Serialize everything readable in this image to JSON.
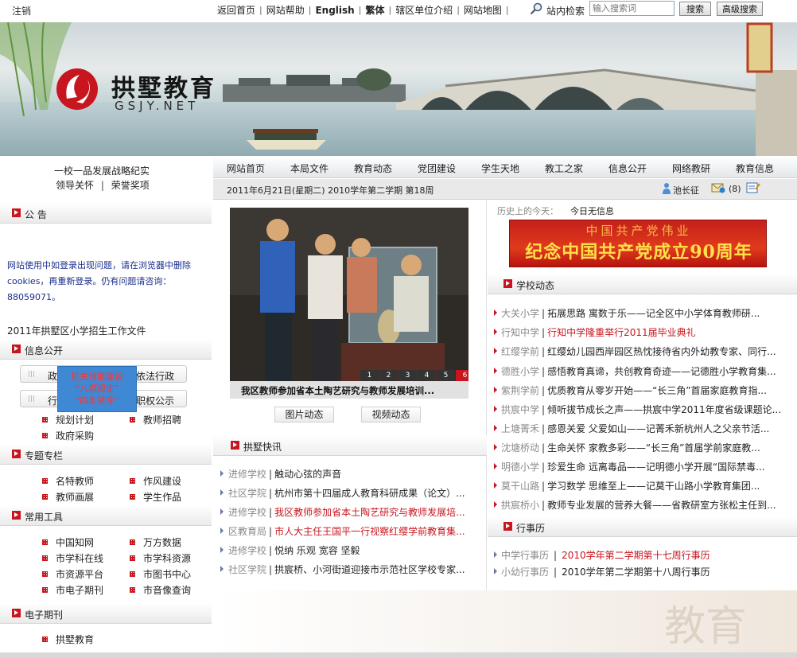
{
  "topbar": {
    "logout": "注销",
    "nav": [
      "返回首页",
      "网站帮助",
      "English",
      "繁体",
      "辖区单位介绍",
      "网站地图"
    ],
    "search_label": "站内检索",
    "search_placeholder": "输入搜索词",
    "search_button": "搜索",
    "advanced_button": "高级搜索"
  },
  "banner": {
    "logo_cn": "拱墅教育",
    "logo_en": "GSJY.NET"
  },
  "left": {
    "strategy_title": "一校一品发展战略纪实",
    "strategy_link1": "领导关怀",
    "strategy_sep": "|",
    "strategy_link2": "荣誉奖项",
    "notice_title": "公 告",
    "notice_text": "网站使用中如登录出现问题，请在浏览器中删除cookies，再重新登录。仍有问题请咨询：88059071。",
    "enroll_text": "2011年拱墅区小学招生工作文件",
    "info_title": "信息公开",
    "info_pills": [
      "政",
      "依法行政",
      "行",
      "职权公示"
    ],
    "popup_lines": [
      "机关效能建设",
      "“八项规定”",
      "“四条禁令”"
    ],
    "info_links": [
      "规划计划",
      "教师招聘",
      "政府采购"
    ],
    "special_title": "专题专栏",
    "special_links": [
      "名特教师",
      "作风建设",
      "教师画展",
      "学生作品"
    ],
    "tools_title": "常用工具",
    "tools_links": [
      "中国知网",
      "万方数据",
      "市学科在线",
      "市学科资源",
      "市资源平台",
      "市图书中心",
      "市电子期刊",
      "市音像查询"
    ],
    "journal_title": "电子期刊",
    "journal_links": [
      "拱墅教育"
    ]
  },
  "mainnav": {
    "items": [
      "网站首页",
      "本局文件",
      "教育动态",
      "党团建设",
      "学生天地",
      "教工之家",
      "信息公开",
      "网络教研",
      "教育信息"
    ]
  },
  "datebar": {
    "date": "2011年6月21日(星期二) 2010学年第二学期 第18周",
    "user": "池长征",
    "mail_count": "(8)"
  },
  "center": {
    "photo_caption": "我区教师参加省本土陶艺研究与教师发展培训...",
    "slide_numbers": [
      "1",
      "2",
      "3",
      "4",
      "5",
      "6"
    ],
    "tab_photo": "图片动态",
    "tab_video": "视频动态",
    "news_title": "拱墅快讯",
    "news": [
      {
        "src": "进修学校",
        "title": "触动心弦的声音",
        "red": false
      },
      {
        "src": "社区学院",
        "title": "杭州市第十四届成人教育科研成果（论文）...",
        "red": false
      },
      {
        "src": "进修学校",
        "title": "我区教师参加省本土陶艺研究与教师发展培...",
        "red": true
      },
      {
        "src": "区教育局",
        "title": "市人大主任王国平一行视察红缨学前教育集...",
        "red": true
      },
      {
        "src": "进修学校",
        "title": "悦纳 乐观 宽容 坚毅",
        "red": false
      },
      {
        "src": "社区学院",
        "title": "拱宸桥、小河街道迎接市示范社区学校专家...",
        "red": false
      }
    ]
  },
  "right": {
    "history_label": "历史上的今天：",
    "history_text": "今日无信息",
    "party_top": "中国共产党伟业",
    "party_main": "纪念中国共产党成立90周年",
    "school_news_title": "学校动态",
    "school_news": [
      {
        "src": "大关小学",
        "title": "拓展思路 寓数于乐——记全区中小学体育教师研...",
        "red": false
      },
      {
        "src": "行知中学",
        "title": "行知中学隆重举行2011届毕业典礼",
        "red": true
      },
      {
        "src": "红缨学前",
        "title": "红缨幼儿园西岸园区热忱接待省内外幼教专家、同行...",
        "red": false
      },
      {
        "src": "德胜小学",
        "title": "感悟教育真谛，共创教育奇迹——记德胜小学教育集...",
        "red": false
      },
      {
        "src": "紫荆学前",
        "title": "优质教育从零岁开始——“长三角”首届家庭教育指...",
        "red": false
      },
      {
        "src": "拱宸中学",
        "title": "倾听拔节成长之声——拱宸中学2011年度省级课题论...",
        "red": false
      },
      {
        "src": "上塘菁禾",
        "title": "感恩关爱 父爱如山——记菁禾新杭州人之父亲节活...",
        "red": false
      },
      {
        "src": "沈塘桥动",
        "title": "生命关怀 家教多彩——“长三角”首届学前家庭教...",
        "red": false
      },
      {
        "src": "明德小学",
        "title": "珍爱生命 远离毒品——记明德小学开展“国际禁毒...",
        "red": false
      },
      {
        "src": "莫干山路",
        "title": "学习数学 思维至上——记莫干山路小学教育集团...",
        "red": false
      },
      {
        "src": "拱宸桥小",
        "title": "教师专业发展的营养大餐——省教研室方张松主任到...",
        "red": false
      }
    ],
    "calendar_title": "行事历",
    "calendar": [
      {
        "src": "中学行事历",
        "title": "2010学年第二学期第十七周行事历",
        "red": true
      },
      {
        "src": "小幼行事历",
        "title": "2010学年第二学期第十八周行事历",
        "red": false
      }
    ]
  },
  "footer": {
    "deco_glyph": "教育"
  }
}
